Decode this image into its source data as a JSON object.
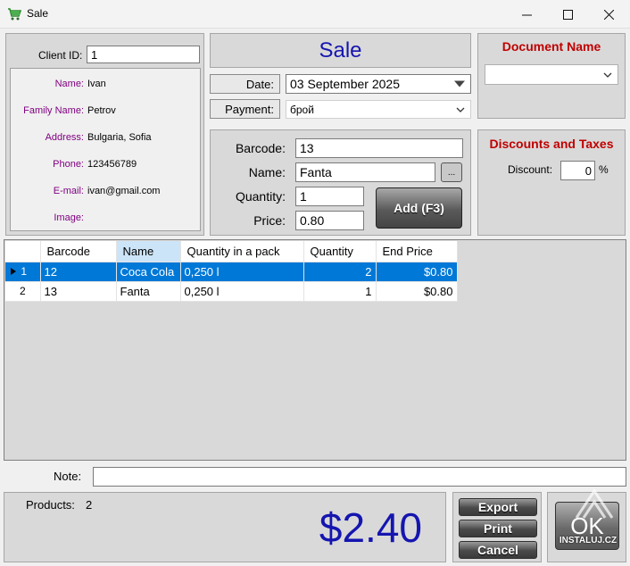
{
  "window": {
    "title": "Sale",
    "app_icon": "cart-icon"
  },
  "client": {
    "id_label": "Client ID:",
    "id_value": "1",
    "name_label": "Name:",
    "name_value": "Ivan",
    "family_label": "Family Name:",
    "family_value": "Petrov",
    "address_label": "Address:",
    "address_value": "Bulgaria, Sofia",
    "phone_label": "Phone:",
    "phone_value": "123456789",
    "email_label": "E-mail:",
    "email_value": "ivan@gmail.com",
    "image_label": "Image:"
  },
  "sale": {
    "title": "Sale",
    "date_label": "Date:",
    "date_value": "03 September 2025",
    "payment_label": "Payment:",
    "payment_value": "брой"
  },
  "document": {
    "title": "Document Name",
    "value": ""
  },
  "discounts": {
    "title": "Discounts and Taxes",
    "discount_label": "Discount:",
    "discount_value": "0",
    "percent_sign": "%"
  },
  "product_entry": {
    "barcode_label": "Barcode:",
    "barcode_value": "13",
    "name_label": "Name:",
    "name_value": "Fanta",
    "browse_label": "...",
    "quantity_label": "Quantity:",
    "quantity_value": "1",
    "price_label": "Price:",
    "price_value": "0.80",
    "add_button": "Add (F3)"
  },
  "grid": {
    "columns": [
      "Barcode",
      "Name",
      "Quantity in a pack",
      "Quantity",
      "End Price"
    ],
    "rows": [
      {
        "index": "1",
        "barcode": "12",
        "name": "Coca Cola",
        "pack": "0,250 l",
        "quantity": "2",
        "end_price": "$0.80"
      },
      {
        "index": "2",
        "barcode": "13",
        "name": "Fanta",
        "pack": "0,250 l",
        "quantity": "1",
        "end_price": "$0.80"
      }
    ]
  },
  "note": {
    "label": "Note:",
    "value": ""
  },
  "summary": {
    "products_label": "Products:",
    "products_count": "2",
    "total": "$2.40"
  },
  "actions": {
    "export": "Export",
    "print": "Print",
    "cancel": "Cancel",
    "ok": "OK"
  },
  "watermark": {
    "text": "INSTALUJ.CZ"
  },
  "colors": {
    "accent_blue": "#1515b0",
    "selection": "#0078d7",
    "red_title": "#c00000",
    "label_purple": "#800080"
  }
}
